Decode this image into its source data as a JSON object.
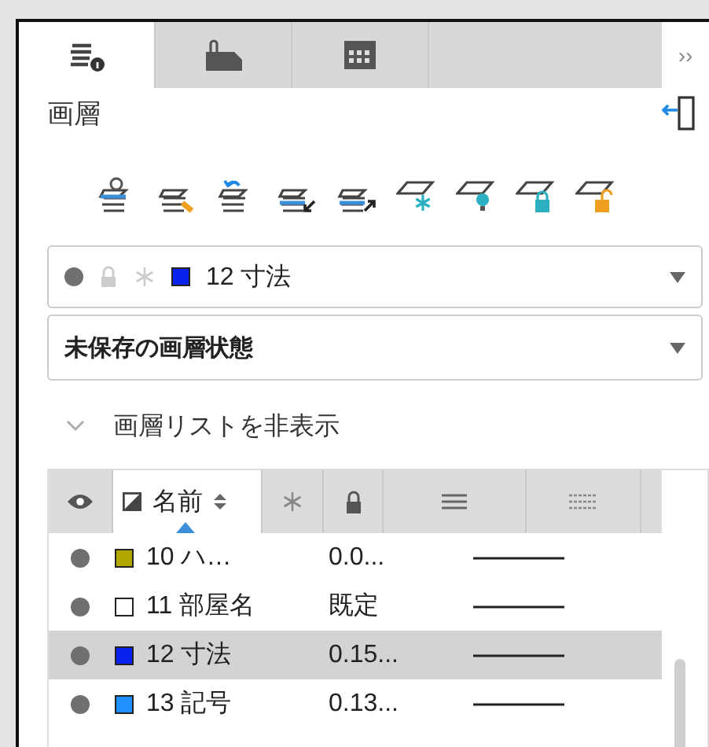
{
  "tabs": [
    {
      "kind": "layers-info",
      "selected": true
    },
    {
      "kind": "clip-document",
      "selected": false
    },
    {
      "kind": "calendar-grid",
      "selected": false
    }
  ],
  "overflow_button": "››",
  "panel_title": "画層",
  "current_layer": {
    "name": "12 寸法",
    "color": "#0a22ee"
  },
  "layer_state": {
    "value": "未保存の画層状態"
  },
  "list_toggle": {
    "label": "画層リストを非表示",
    "expanded": true
  },
  "table": {
    "columns": [
      {
        "kind": "visible"
      },
      {
        "kind": "name",
        "label": "名前",
        "selected": true
      },
      {
        "kind": "freeze"
      },
      {
        "kind": "lock"
      },
      {
        "kind": "weight"
      },
      {
        "kind": "linetype"
      }
    ],
    "rows": [
      {
        "visible": true,
        "color": "#b3a800",
        "name": "10 ハ…",
        "weight": "0.0...",
        "selected": false
      },
      {
        "visible": true,
        "color": "#ffffff",
        "name": "11 部屋名",
        "weight": "既定",
        "selected": false
      },
      {
        "visible": true,
        "color": "#0a22ee",
        "name": "12 寸法",
        "weight": "0.15...",
        "selected": true
      },
      {
        "visible": true,
        "color": "#1e90ff",
        "name": "13 記号",
        "weight": "0.13...",
        "selected": false
      }
    ]
  }
}
